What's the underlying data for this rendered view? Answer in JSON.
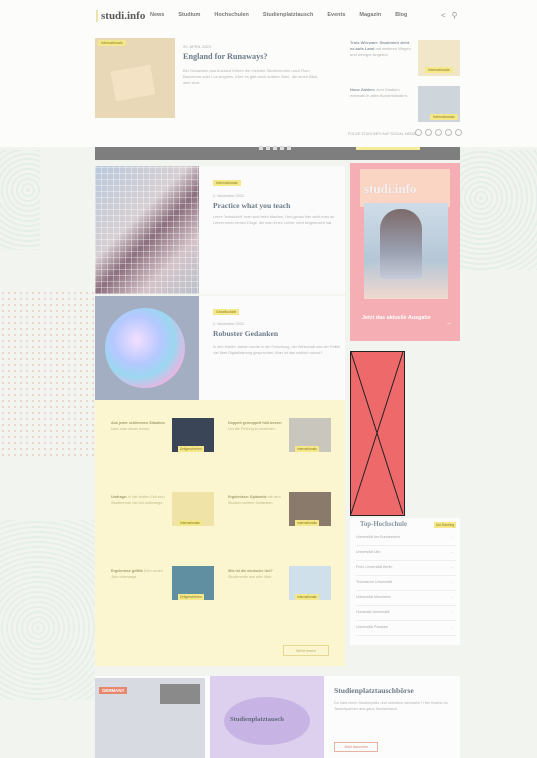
{
  "header": {
    "logo": "studi.info",
    "nav": [
      "News",
      "Studium",
      "Hochschulen",
      "Studienplatztausch",
      "Events",
      "Magazin",
      "Blog"
    ]
  },
  "hero": {
    "badge": "Internationals",
    "date": "20. APRIL 2023",
    "title": "England for Runaways?",
    "text": "Bei Gedanken ans Ausland führen die meisten Studierenden nach Rom, Barcelona oder Los Angeles. Aber es gibt auch andere Ziele, die einen Blick wert sind."
  },
  "side_news": [
    {
      "title": "Trotz Wirrwarr: Studenten zieht es aufs Land",
      "text": "mit weiteren Wegen und weniger Angebot.",
      "badge": "Internationals"
    },
    {
      "title": "Neue Zahlen:",
      "text": "zum Studium erstmals in allen Bundesländern.",
      "badge": "Internationals"
    }
  ],
  "follow_label": "FOLGE STUDI.INFO AUF SOCIAL MEDIA",
  "articles": [
    {
      "badge": "Internationals",
      "date": "2. November 2022",
      "title": "Practice what you teach",
      "text": "Lehre \"entwickelt\" man sich beim Machen. Und genau hier setzt man an. Lehrer:innen lernen Dinge, die man ihnen vorher nicht beigebracht hat."
    },
    {
      "badge": "Gesellschaft",
      "date": "2. November 2022",
      "title": "Robuster Gedanken",
      "text": "In den letzten Jahren wurde in der Forschung, der Wirtschaft und der Politik viel über Digitalisierung gesprochen. Aber ist das wirklich robust?"
    }
  ],
  "magazine": {
    "logo": "studi.info",
    "cta": "Jetzt das aktuelle Ausgabe"
  },
  "news_grid": [
    {
      "title": "Aus jeder schlimmen Situation",
      "text": "kann man etwas lernen.",
      "badge": "Zeitgeschehen"
    },
    {
      "title": "Doppelt gemoppelt hält besser",
      "text": "Um die Prüfung zu bestehen.",
      "badge": "Internationals"
    },
    {
      "title": "Umfrage:",
      "text": "In der letzten Zeit sind Studierende viel Uni unterwegs.",
      "badge": "Internationals"
    },
    {
      "title": "Ergebnisse: Epidemie",
      "text": "mit dem Studium weitere Gedanken.",
      "badge": "Internationals"
    },
    {
      "title": "Ergebnisse gefällt",
      "text": "Dem neuen Jahr unterwegs.",
      "badge": "Zeitgeschehen"
    },
    {
      "title": "Wie ist die deutsche Uni?",
      "text": "Studierende aus aller Welt.",
      "badge": "Internationals"
    }
  ],
  "more_button": "Mehr lesen",
  "ranking": {
    "title": "Top-Hochschule",
    "badge": "Uni-Ranking",
    "items": [
      "Universität der Bundeswehr",
      "Universität Ulm",
      "Freie Universität Berlin",
      "Technische Universität",
      "Universität Mannheim",
      "Humboldt-Universität",
      "Universität Potsdam"
    ]
  },
  "promo": {
    "germany_badge": "GERMANY",
    "image_label": "Studienplatztausch",
    "title": "Studienplatztauschbörse",
    "text": "Du hast einen Studienplatz und möchtest wechseln? Hier findest du Tauschpartner aus ganz Deutschland.",
    "button": "Jetzt tauschen"
  }
}
